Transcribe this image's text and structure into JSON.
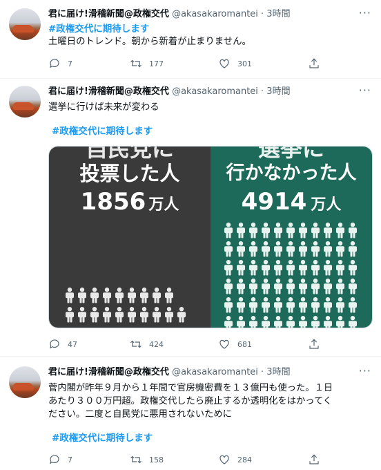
{
  "tweets": [
    {
      "name": "君に届け!滑稽新聞@政権交代",
      "handle": "@akasakaromantei · 3時間",
      "hashtag_top": "#政権交代に期待します",
      "text": "土曜日のトレンド。朝から新着が止まりません。",
      "replies": "7",
      "retweets": "177",
      "likes": "301"
    },
    {
      "name": "君に届け!滑稽新聞@政権交代",
      "handle": "@akasakaromantei · 3時間",
      "text": "選挙に行けば未来が変わる",
      "hashtag": "#政権交代に期待します",
      "image": {
        "left_heading": "自民党に",
        "left_line2": "投票した人",
        "left_number": "1856",
        "left_unit": "万人",
        "right_heading": "選挙に",
        "right_line2": "行かなかった人",
        "right_number": "4914",
        "right_unit": "万人",
        "left_color": "#3a3a3a",
        "right_color": "#1e6a5a"
      },
      "replies": "47",
      "retweets": "424",
      "likes": "681"
    },
    {
      "name": "君に届け!滑稽新聞@政権交代",
      "handle": "@akasakaromantei · 3時間",
      "text_line1": "菅内閣が昨年９月から１年間で官房機密費を１３億円も使った。１日",
      "text_line2": "あたり３００万円超。政権交代したら廃止するか透明化をはかってく",
      "text_line3": "ださい。二度と自民党に悪用されないために",
      "hashtag": "#政権交代に期待します",
      "replies": "7",
      "retweets": "158",
      "likes": "284"
    }
  ],
  "icons": [
    "reply-icon",
    "retweet-icon",
    "like-icon",
    "share-icon",
    "more-icon"
  ],
  "colors": {
    "link": "#1d9bf0",
    "secondary": "#536471"
  }
}
